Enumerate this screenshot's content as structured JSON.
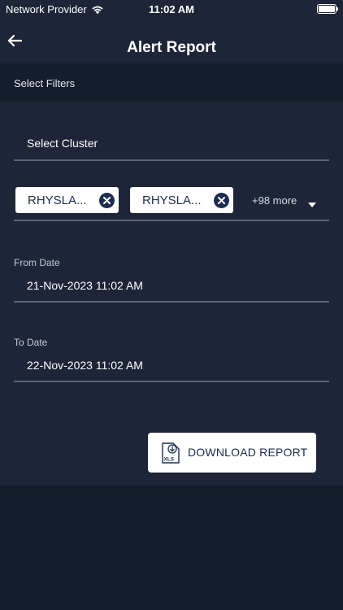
{
  "status_bar": {
    "carrier": "Network Provider",
    "time": "11:02 AM"
  },
  "header": {
    "title": "Alert Report",
    "back_icon": "arrow-left-icon"
  },
  "filters": {
    "section_label": "Select Filters",
    "cluster_label": "Select Cluster",
    "chips": [
      {
        "label": "RHYSLA..."
      },
      {
        "label": "RHYSLA..."
      }
    ],
    "more_count": "+98 more",
    "from_date": {
      "label": "From Date",
      "value": "21-Nov-2023  11:02 AM"
    },
    "to_date": {
      "label": "To Date",
      "value": "22-Nov-2023  11:02 AM"
    }
  },
  "actions": {
    "download_label": "DOWNLOAD REPORT",
    "download_icon": "xls-download-icon",
    "download_icon_text": "XLS"
  },
  "colors": {
    "background": "#121a2c",
    "panel": "#1e2538",
    "header_strip": "#151c2d",
    "accent_navy": "#1c2d4e",
    "divider": "#5d6476"
  }
}
